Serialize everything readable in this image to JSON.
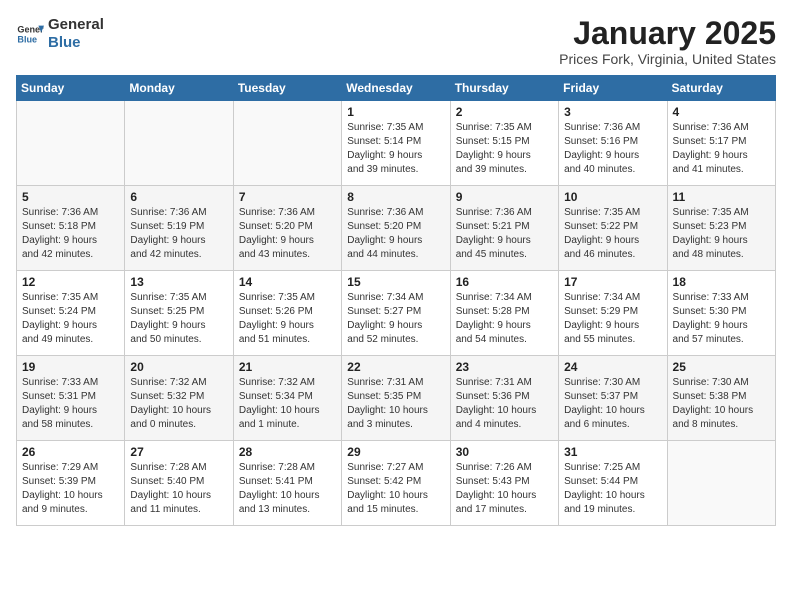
{
  "header": {
    "logo_line1": "General",
    "logo_line2": "Blue",
    "title": "January 2025",
    "subtitle": "Prices Fork, Virginia, United States"
  },
  "days_of_week": [
    "Sunday",
    "Monday",
    "Tuesday",
    "Wednesday",
    "Thursday",
    "Friday",
    "Saturday"
  ],
  "weeks": [
    [
      {
        "day": "",
        "info": ""
      },
      {
        "day": "",
        "info": ""
      },
      {
        "day": "",
        "info": ""
      },
      {
        "day": "1",
        "info": "Sunrise: 7:35 AM\nSunset: 5:14 PM\nDaylight: 9 hours\nand 39 minutes."
      },
      {
        "day": "2",
        "info": "Sunrise: 7:35 AM\nSunset: 5:15 PM\nDaylight: 9 hours\nand 39 minutes."
      },
      {
        "day": "3",
        "info": "Sunrise: 7:36 AM\nSunset: 5:16 PM\nDaylight: 9 hours\nand 40 minutes."
      },
      {
        "day": "4",
        "info": "Sunrise: 7:36 AM\nSunset: 5:17 PM\nDaylight: 9 hours\nand 41 minutes."
      }
    ],
    [
      {
        "day": "5",
        "info": "Sunrise: 7:36 AM\nSunset: 5:18 PM\nDaylight: 9 hours\nand 42 minutes."
      },
      {
        "day": "6",
        "info": "Sunrise: 7:36 AM\nSunset: 5:19 PM\nDaylight: 9 hours\nand 42 minutes."
      },
      {
        "day": "7",
        "info": "Sunrise: 7:36 AM\nSunset: 5:20 PM\nDaylight: 9 hours\nand 43 minutes."
      },
      {
        "day": "8",
        "info": "Sunrise: 7:36 AM\nSunset: 5:20 PM\nDaylight: 9 hours\nand 44 minutes."
      },
      {
        "day": "9",
        "info": "Sunrise: 7:36 AM\nSunset: 5:21 PM\nDaylight: 9 hours\nand 45 minutes."
      },
      {
        "day": "10",
        "info": "Sunrise: 7:35 AM\nSunset: 5:22 PM\nDaylight: 9 hours\nand 46 minutes."
      },
      {
        "day": "11",
        "info": "Sunrise: 7:35 AM\nSunset: 5:23 PM\nDaylight: 9 hours\nand 48 minutes."
      }
    ],
    [
      {
        "day": "12",
        "info": "Sunrise: 7:35 AM\nSunset: 5:24 PM\nDaylight: 9 hours\nand 49 minutes."
      },
      {
        "day": "13",
        "info": "Sunrise: 7:35 AM\nSunset: 5:25 PM\nDaylight: 9 hours\nand 50 minutes."
      },
      {
        "day": "14",
        "info": "Sunrise: 7:35 AM\nSunset: 5:26 PM\nDaylight: 9 hours\nand 51 minutes."
      },
      {
        "day": "15",
        "info": "Sunrise: 7:34 AM\nSunset: 5:27 PM\nDaylight: 9 hours\nand 52 minutes."
      },
      {
        "day": "16",
        "info": "Sunrise: 7:34 AM\nSunset: 5:28 PM\nDaylight: 9 hours\nand 54 minutes."
      },
      {
        "day": "17",
        "info": "Sunrise: 7:34 AM\nSunset: 5:29 PM\nDaylight: 9 hours\nand 55 minutes."
      },
      {
        "day": "18",
        "info": "Sunrise: 7:33 AM\nSunset: 5:30 PM\nDaylight: 9 hours\nand 57 minutes."
      }
    ],
    [
      {
        "day": "19",
        "info": "Sunrise: 7:33 AM\nSunset: 5:31 PM\nDaylight: 9 hours\nand 58 minutes."
      },
      {
        "day": "20",
        "info": "Sunrise: 7:32 AM\nSunset: 5:32 PM\nDaylight: 10 hours\nand 0 minutes."
      },
      {
        "day": "21",
        "info": "Sunrise: 7:32 AM\nSunset: 5:34 PM\nDaylight: 10 hours\nand 1 minute."
      },
      {
        "day": "22",
        "info": "Sunrise: 7:31 AM\nSunset: 5:35 PM\nDaylight: 10 hours\nand 3 minutes."
      },
      {
        "day": "23",
        "info": "Sunrise: 7:31 AM\nSunset: 5:36 PM\nDaylight: 10 hours\nand 4 minutes."
      },
      {
        "day": "24",
        "info": "Sunrise: 7:30 AM\nSunset: 5:37 PM\nDaylight: 10 hours\nand 6 minutes."
      },
      {
        "day": "25",
        "info": "Sunrise: 7:30 AM\nSunset: 5:38 PM\nDaylight: 10 hours\nand 8 minutes."
      }
    ],
    [
      {
        "day": "26",
        "info": "Sunrise: 7:29 AM\nSunset: 5:39 PM\nDaylight: 10 hours\nand 9 minutes."
      },
      {
        "day": "27",
        "info": "Sunrise: 7:28 AM\nSunset: 5:40 PM\nDaylight: 10 hours\nand 11 minutes."
      },
      {
        "day": "28",
        "info": "Sunrise: 7:28 AM\nSunset: 5:41 PM\nDaylight: 10 hours\nand 13 minutes."
      },
      {
        "day": "29",
        "info": "Sunrise: 7:27 AM\nSunset: 5:42 PM\nDaylight: 10 hours\nand 15 minutes."
      },
      {
        "day": "30",
        "info": "Sunrise: 7:26 AM\nSunset: 5:43 PM\nDaylight: 10 hours\nand 17 minutes."
      },
      {
        "day": "31",
        "info": "Sunrise: 7:25 AM\nSunset: 5:44 PM\nDaylight: 10 hours\nand 19 minutes."
      },
      {
        "day": "",
        "info": ""
      }
    ]
  ]
}
